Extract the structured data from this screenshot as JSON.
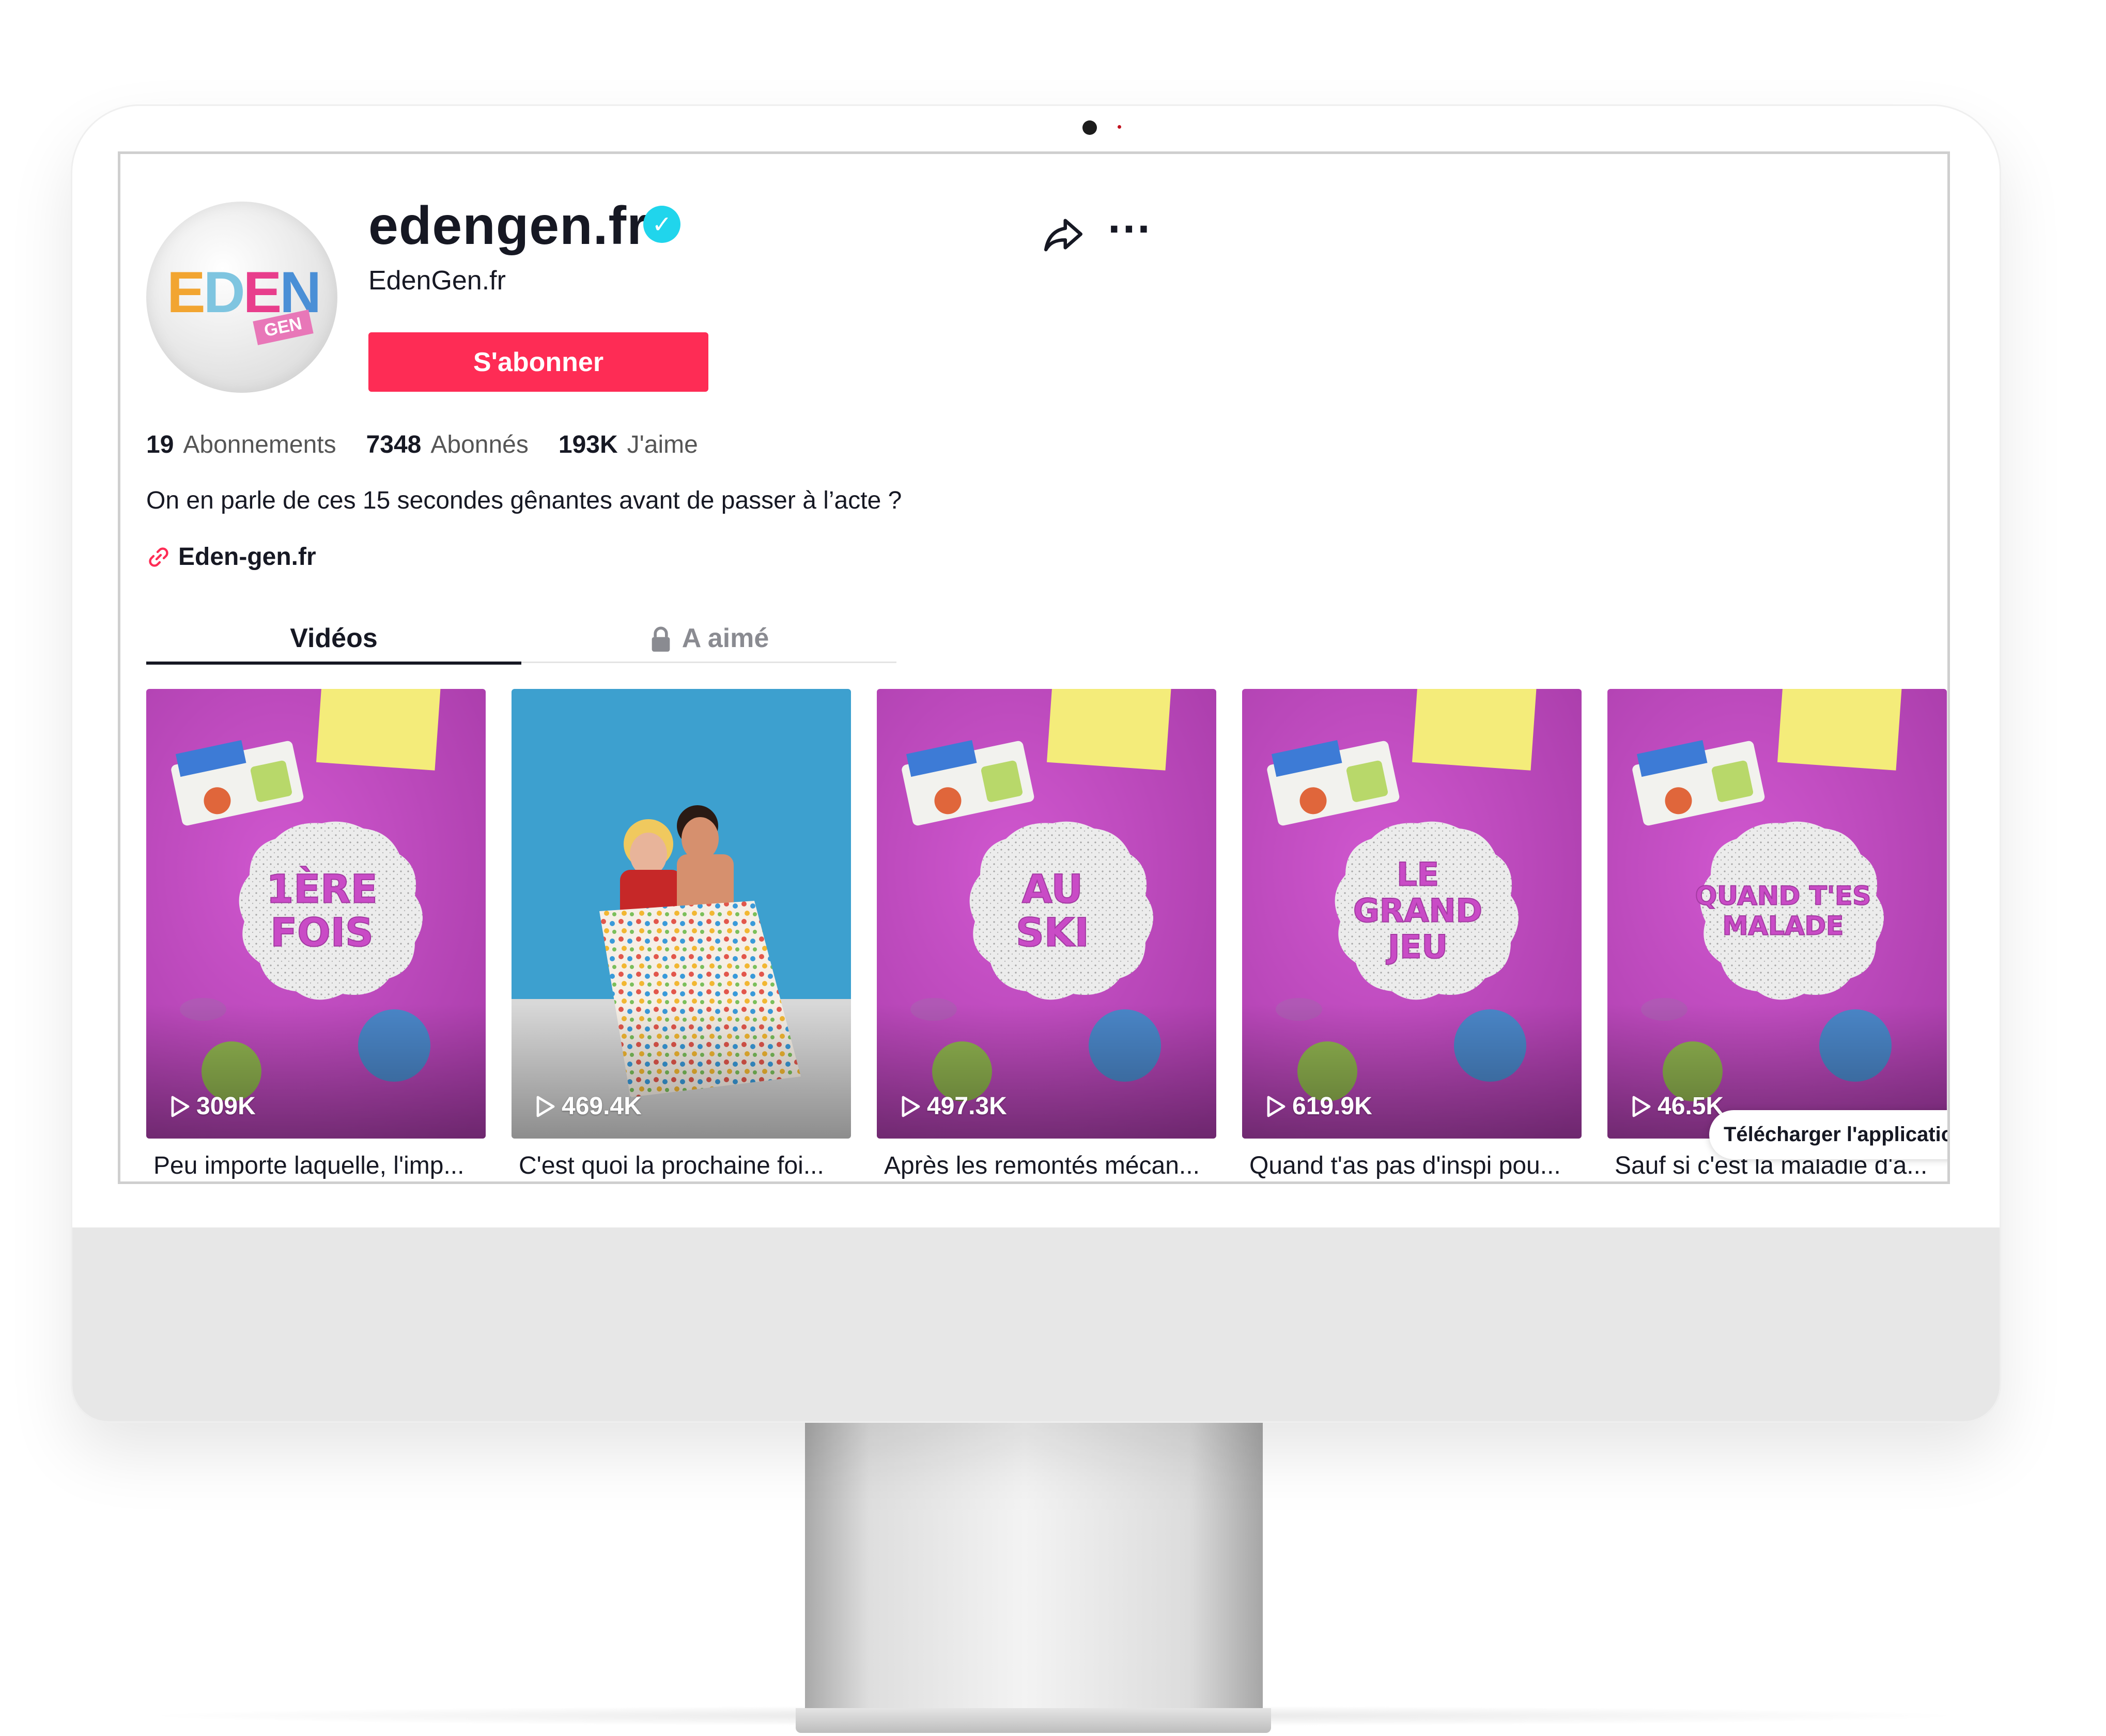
{
  "profile": {
    "username": "edengen.fr",
    "nickname": "EdenGen.fr",
    "avatar_logo": {
      "word": "EDEN",
      "badge": "GEN"
    },
    "follow_label": "S'abonner",
    "stats": [
      {
        "value": "19",
        "label": "Abonnements"
      },
      {
        "value": "7348",
        "label": "Abonnés"
      },
      {
        "value": "193K",
        "label": "J'aime"
      }
    ],
    "bio": "On en parle de ces 15 secondes gênantes avant de passer à l’acte ?",
    "link": "Eden-gen.fr"
  },
  "tabs": [
    {
      "label": "Vidéos",
      "active": true
    },
    {
      "label": "A aimé",
      "locked": true
    }
  ],
  "videos": [
    {
      "views": "309K",
      "caption": "Peu importe laquelle, l'imp...",
      "overlay": [
        "1ÈRE",
        "FOIS"
      ]
    },
    {
      "views": "469.4K",
      "caption": "C'est quoi la prochaine foi...",
      "overlay": []
    },
    {
      "views": "497.3K",
      "caption": "Après les remontés mécan...",
      "overlay": [
        "AU",
        "SKI"
      ]
    },
    {
      "views": "619.9K",
      "caption": "Quand t'as pas d'inspi pou...",
      "overlay": [
        "LE",
        "GRAND",
        "JEU"
      ]
    },
    {
      "views": "46.5K",
      "caption": "Sauf si c'est la maladie d'a...",
      "overlay": [
        "QUAND T'ES",
        "MALADE"
      ]
    }
  ],
  "download_app": "Télécharger l'applicatio",
  "colors": {
    "follow_button": "#fe2c55",
    "verified_badge": "#20d5ec",
    "clay_background": "#c04ac0",
    "wall_blue": "#3da0cf",
    "text_primary": "#161823"
  },
  "icons": [
    "verified-icon",
    "share-icon",
    "more-icon",
    "link-icon",
    "lock-icon",
    "play-icon"
  ]
}
